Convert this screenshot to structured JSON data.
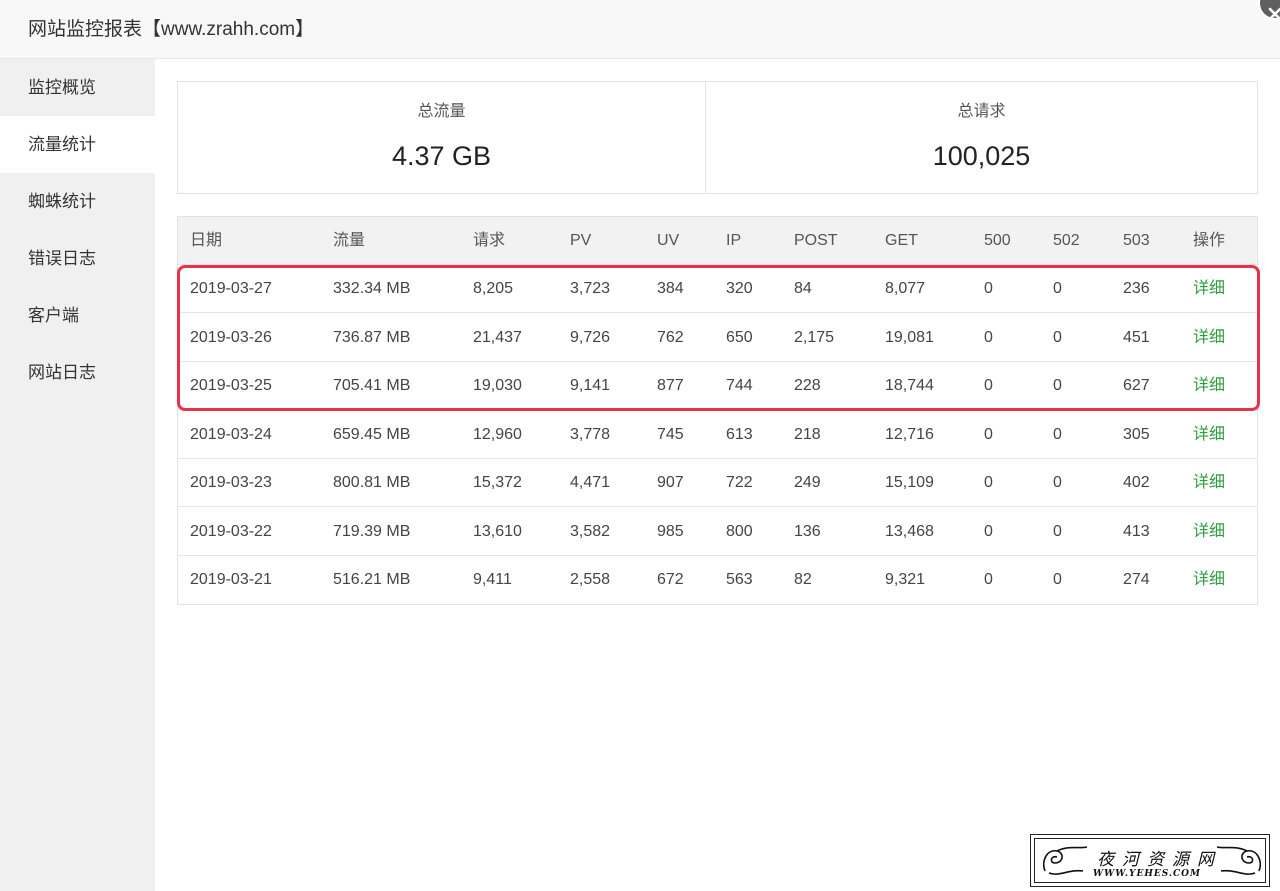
{
  "window": {
    "title": "网站监控报表【www.zrahh.com】"
  },
  "sidebar": {
    "active_index": 1,
    "items": [
      {
        "label": "监控概览"
      },
      {
        "label": "流量统计"
      },
      {
        "label": "蜘蛛统计"
      },
      {
        "label": "错误日志"
      },
      {
        "label": "客户端"
      },
      {
        "label": "网站日志"
      }
    ]
  },
  "summary": {
    "traffic": {
      "label": "总流量",
      "value": "4.37 GB"
    },
    "requests": {
      "label": "总请求",
      "value": "100,025"
    }
  },
  "table": {
    "headers": [
      "日期",
      "流量",
      "请求",
      "PV",
      "UV",
      "IP",
      "POST",
      "GET",
      "500",
      "502",
      "503",
      "操作"
    ],
    "rows": [
      {
        "date": "2019-03-27",
        "traffic": "332.34 MB",
        "requests": "8,205",
        "pv": "3,723",
        "uv": "384",
        "ip": "320",
        "post": "84",
        "get": "8,077",
        "e500": "0",
        "e502": "0",
        "e503": "236",
        "action": "详细"
      },
      {
        "date": "2019-03-26",
        "traffic": "736.87 MB",
        "requests": "21,437",
        "pv": "9,726",
        "uv": "762",
        "ip": "650",
        "post": "2,175",
        "get": "19,081",
        "e500": "0",
        "e502": "0",
        "e503": "451",
        "action": "详细"
      },
      {
        "date": "2019-03-25",
        "traffic": "705.41 MB",
        "requests": "19,030",
        "pv": "9,141",
        "uv": "877",
        "ip": "744",
        "post": "228",
        "get": "18,744",
        "e500": "0",
        "e502": "0",
        "e503": "627",
        "action": "详细"
      },
      {
        "date": "2019-03-24",
        "traffic": "659.45 MB",
        "requests": "12,960",
        "pv": "3,778",
        "uv": "745",
        "ip": "613",
        "post": "218",
        "get": "12,716",
        "e500": "0",
        "e502": "0",
        "e503": "305",
        "action": "详细"
      },
      {
        "date": "2019-03-23",
        "traffic": "800.81 MB",
        "requests": "15,372",
        "pv": "4,471",
        "uv": "907",
        "ip": "722",
        "post": "249",
        "get": "15,109",
        "e500": "0",
        "e502": "0",
        "e503": "402",
        "action": "详细"
      },
      {
        "date": "2019-03-22",
        "traffic": "719.39 MB",
        "requests": "13,610",
        "pv": "3,582",
        "uv": "985",
        "ip": "800",
        "post": "136",
        "get": "13,468",
        "e500": "0",
        "e502": "0",
        "e503": "413",
        "action": "详细"
      },
      {
        "date": "2019-03-21",
        "traffic": "516.21 MB",
        "requests": "9,411",
        "pv": "2,558",
        "uv": "672",
        "ip": "563",
        "post": "82",
        "get": "9,321",
        "e500": "0",
        "e502": "0",
        "e503": "274",
        "action": "详细"
      }
    ]
  },
  "watermark": {
    "title": "夜河资源网",
    "subtitle": "WWW.YEHES.COM"
  },
  "colors": {
    "accent_link": "#2e9d3e",
    "highlight_border": "#e8324a",
    "sidebar_bg": "#f0f0f0"
  },
  "icons": {
    "close": "close-icon"
  }
}
